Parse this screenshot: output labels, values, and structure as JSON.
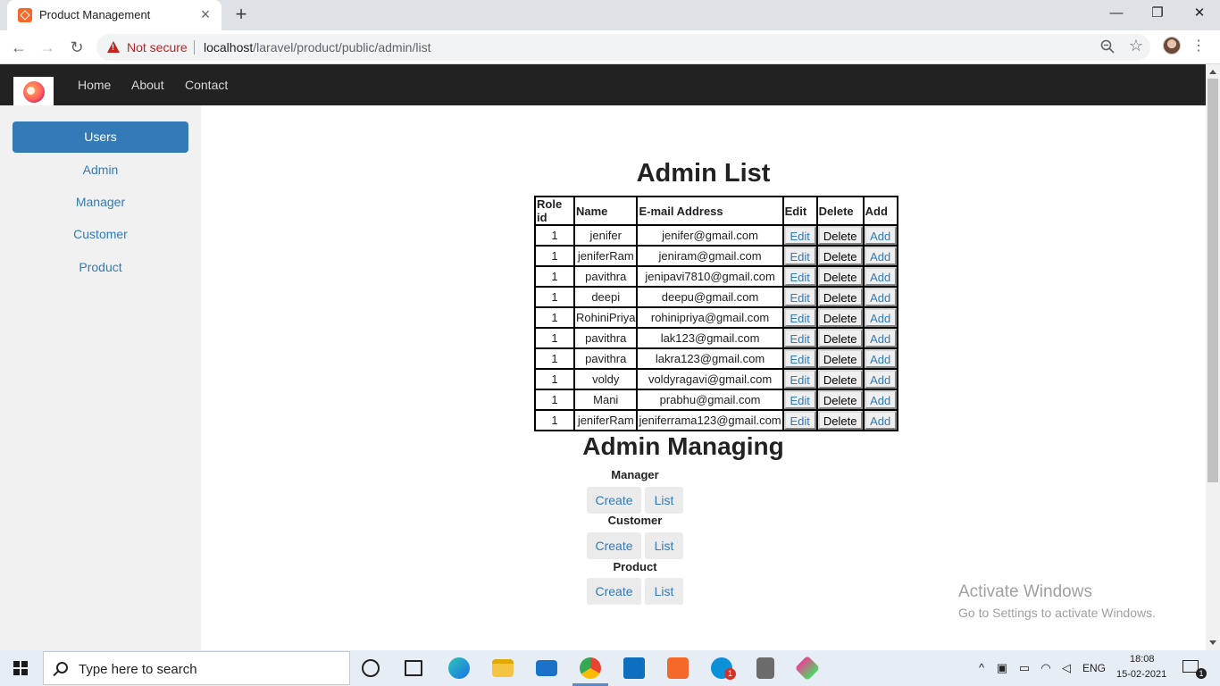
{
  "browser": {
    "tab_title": "Product Management",
    "security_label": "Not secure",
    "url_host": "localhost",
    "url_path": "/laravel/product/public/admin/list"
  },
  "site_nav": {
    "home": "Home",
    "about": "About",
    "contact": "Contact"
  },
  "sidebar": {
    "items": [
      "Users",
      "Admin",
      "Manager",
      "Customer",
      "Product"
    ],
    "active": "Users"
  },
  "main": {
    "title": "Admin List",
    "table": {
      "headers": [
        "Role id",
        "Name",
        "E-mail Address",
        "Edit",
        "Delete",
        "Add"
      ],
      "rows": [
        {
          "role_id": "1",
          "name": "jenifer",
          "email": "jenifer@gmail.com",
          "edit": "Edit",
          "delete": "Delete",
          "add": "Add"
        },
        {
          "role_id": "1",
          "name": "jeniferRam",
          "email": "jeniram@gmail.com",
          "edit": "Edit",
          "delete": "Delete",
          "add": "Add"
        },
        {
          "role_id": "1",
          "name": "pavithra",
          "email": "jenipavi7810@gmail.com",
          "edit": "Edit",
          "delete": "Delete",
          "add": "Add"
        },
        {
          "role_id": "1",
          "name": "deepi",
          "email": "deepu@gmail.com",
          "edit": "Edit",
          "delete": "Delete",
          "add": "Add"
        },
        {
          "role_id": "1",
          "name": "RohiniPriya",
          "email": "rohinipriya@gmail.com",
          "edit": "Edit",
          "delete": "Delete",
          "add": "Add"
        },
        {
          "role_id": "1",
          "name": "pavithra",
          "email": "lak123@gmail.com",
          "edit": "Edit",
          "delete": "Delete",
          "add": "Add"
        },
        {
          "role_id": "1",
          "name": "pavithra",
          "email": "lakra123@gmail.com",
          "edit": "Edit",
          "delete": "Delete",
          "add": "Add"
        },
        {
          "role_id": "1",
          "name": "voldy",
          "email": "voldyragavi@gmail.com",
          "edit": "Edit",
          "delete": "Delete",
          "add": "Add"
        },
        {
          "role_id": "1",
          "name": "Mani",
          "email": "prabhu@gmail.com",
          "edit": "Edit",
          "delete": "Delete",
          "add": "Add"
        },
        {
          "role_id": "1",
          "name": "jeniferRam",
          "email": "jeniferrama123@gmail.com",
          "edit": "Edit",
          "delete": "Delete",
          "add": "Add"
        }
      ]
    },
    "managing": {
      "title": "Admin Managing",
      "groups": [
        {
          "label": "Manager",
          "create": "Create",
          "list": "List"
        },
        {
          "label": "Customer",
          "create": "Create",
          "list": "List"
        },
        {
          "label": "Product",
          "create": "Create",
          "list": "List"
        }
      ]
    }
  },
  "watermark": {
    "line1": "Activate Windows",
    "line2": "Go to Settings to activate Windows."
  },
  "taskbar": {
    "search_placeholder": "Type here to search",
    "apps": [
      "cortana-icon",
      "task-view-icon",
      "edge-icon",
      "file-explorer-icon",
      "mail-icon",
      "chrome-icon",
      "vscode-icon",
      "xampp-icon",
      "skype-icon",
      "calculator-icon",
      "git-icon"
    ],
    "skype_badge": "1",
    "language": "ENG",
    "time": "18:08",
    "date": "15-02-2021",
    "notification_count": "1"
  },
  "colors": {
    "link": "#337ab7",
    "navbar": "#222222",
    "sidebar_bg": "#f1f1f1",
    "warning": "#c5221f"
  }
}
